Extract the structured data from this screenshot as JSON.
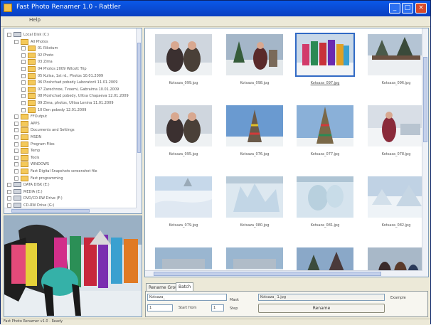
{
  "window": {
    "title": "Fast Photo Renamer 1.0 - Rattler",
    "minimize": "_",
    "maximize": "□",
    "close": "×"
  },
  "menu": {
    "items": [
      "Help"
    ]
  },
  "tree": [
    {
      "label": "Local Disk (C:)",
      "kind": "drive",
      "expanded": true
    },
    {
      "label": "All Photos",
      "kind": "folder",
      "expanded": true
    },
    {
      "label": "01 Rikstum",
      "kind": "folder"
    },
    {
      "label": "02 Photo",
      "kind": "folder"
    },
    {
      "label": "03 Zima",
      "kind": "folder"
    },
    {
      "label": "04 Photos 2009 Wilcott Trip",
      "kind": "folder"
    },
    {
      "label": "05 Kulisa, 1st rd., Photos 10.01.2009",
      "kind": "folder"
    },
    {
      "label": "06 Ploshchad pobedy Laboratorii 11.01.2009",
      "kind": "folder"
    },
    {
      "label": "07 Zarechnoe, Tvoemi, Gabraima 10.01.2009",
      "kind": "folder"
    },
    {
      "label": "08 Ploshchad pobedy, Ulitsa Chapaeva 12.01.2009",
      "kind": "folder"
    },
    {
      "label": "09 Zima, photos, Ulitsa Lenina 11.01.2009",
      "kind": "folder"
    },
    {
      "label": "10 Den pobedy 12.01.2009",
      "kind": "folder"
    },
    {
      "label": "FFOutput",
      "kind": "folder"
    },
    {
      "label": "APPS",
      "kind": "folder"
    },
    {
      "label": "Documents and Settings",
      "kind": "folder"
    },
    {
      "label": "MSDN",
      "kind": "folder"
    },
    {
      "label": "Program Files",
      "kind": "folder"
    },
    {
      "label": "Temp",
      "kind": "folder"
    },
    {
      "label": "Tools",
      "kind": "folder"
    },
    {
      "label": "WINDOWS",
      "kind": "folder"
    },
    {
      "label": "Fast Digital Snapshots screenshot file",
      "kind": "folder"
    },
    {
      "label": "Fast programming",
      "kind": "folder"
    },
    {
      "label": "DATA DISK (E:)",
      "kind": "drive"
    },
    {
      "label": "MEDIA (E:)",
      "kind": "drive"
    },
    {
      "label": "DVD/CD-RW Drive (F:)",
      "kind": "drive"
    },
    {
      "label": "CD-RW Drive (G:)",
      "kind": "drive"
    }
  ],
  "thumbnails": [
    {
      "caption": "Kotsaza_099.jpg",
      "scene": "people",
      "selected": false
    },
    {
      "caption": "Kotsaza_098.jpg",
      "scene": "people-tree",
      "selected": false
    },
    {
      "caption": "Kotsaza_097.jpg",
      "scene": "crowd",
      "selected": true
    },
    {
      "caption": "Kotsaza_096.jpg",
      "scene": "trees",
      "selected": false
    },
    {
      "caption": "Kotsaza_095.jpg",
      "scene": "people",
      "selected": false
    },
    {
      "caption": "Kotsaza_076.jpg",
      "scene": "tower",
      "selected": false
    },
    {
      "caption": "Kotsaza_077.jpg",
      "scene": "tower-tall",
      "selected": false
    },
    {
      "caption": "Kotsaza_078.jpg",
      "scene": "snow-person",
      "selected": false
    },
    {
      "caption": "Kotsaza_079.jpg",
      "scene": "snow",
      "selected": false
    },
    {
      "caption": "Kotsaza_080.jpg",
      "scene": "ice",
      "selected": false
    },
    {
      "caption": "Kotsaza_081.jpg",
      "scene": "ice2",
      "selected": false
    },
    {
      "caption": "Kotsaza_082.jpg",
      "scene": "snow2",
      "selected": false
    },
    {
      "caption": "",
      "scene": "snow3",
      "selected": false
    },
    {
      "caption": "",
      "scene": "snow3",
      "selected": false
    },
    {
      "caption": "",
      "scene": "trees2",
      "selected": false
    },
    {
      "caption": "",
      "scene": "people2",
      "selected": false
    }
  ],
  "bottom": {
    "tabs": [
      "Rename Group",
      "Batch"
    ],
    "active_tab": 1,
    "mask_value": "Kotsaza_",
    "mask_label": "Mask",
    "start_value": "1",
    "start_label": "Start from",
    "step_value": "1",
    "step_label": "Step",
    "example_value": "Kotsaza_ 1.jpg",
    "example_label": "Example",
    "rename_button": "Rename"
  },
  "status": {
    "text": "Fast Photo Renamer v1.0 - Ready"
  },
  "colors": {
    "titlebar": "#0a4ad8",
    "selection": "#316ac5",
    "folder": "#f4c95a",
    "window_bg": "#ece9d8"
  }
}
